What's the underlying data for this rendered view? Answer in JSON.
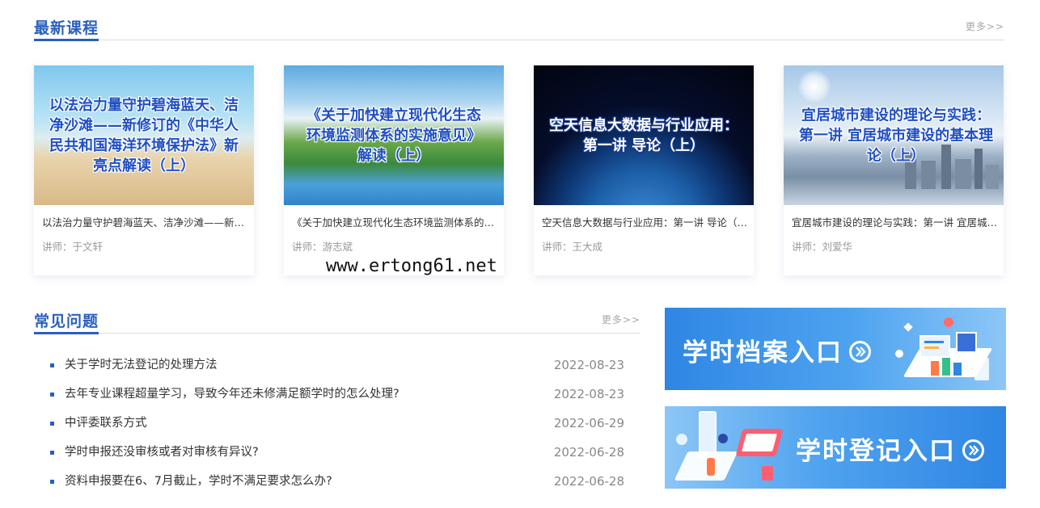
{
  "courses_section": {
    "title": "最新课程",
    "more": "更多>>",
    "cards": [
      {
        "image_text": "以法治力量守护碧海蓝天、洁净沙滩——新修订的《中华人民共和国海洋环境保护法》新亮点解读（上）",
        "title": "以法治力量守护碧海蓝天、洁净沙滩——新修订的《中华人民共和国海洋环境保护法》新亮点解读（上）",
        "teacher": "讲师：于文轩"
      },
      {
        "image_text": "《关于加快建立现代化生态环境监测体系的实施意见》解读（上）",
        "title": "《关于加快建立现代化生态环境监测体系的实施意见》解读（上）",
        "teacher": "讲师：游志斌"
      },
      {
        "image_text": "空天信息大数据与行业应用：第一讲 导论（上）",
        "title": "空天信息大数据与行业应用：第一讲 导论（上）",
        "teacher": "讲师：王大成"
      },
      {
        "image_text": "宜居城市建设的理论与实践：第一讲 宜居城市建设的基本理论（上）",
        "title": "宜居城市建设的理论与实践：第一讲 宜居城市建设的基本理论（上）",
        "teacher": "讲师：刘爱华"
      }
    ]
  },
  "faq_section": {
    "title": "常见问题",
    "more": "更多>>",
    "items": [
      {
        "title": "关于学时无法登记的处理方法",
        "date": "2022-08-23"
      },
      {
        "title": "去年专业课程超量学习，导致今年还未修满足额学时的怎么处理?",
        "date": "2022-08-23"
      },
      {
        "title": "中评委联系方式",
        "date": "2022-06-29"
      },
      {
        "title": "学时申报还没审核或者对审核有异议?",
        "date": "2022-06-28"
      },
      {
        "title": "资料申报要在6、7月截止，学时不满足要求怎么办?",
        "date": "2022-06-28"
      }
    ]
  },
  "banners": {
    "archive": "学时档案入口",
    "register": "学时登记入口"
  },
  "watermark": "www.ertong61.net",
  "colors": {
    "accent": "#2a5fbf",
    "banner_blue": "#2f86e3"
  }
}
